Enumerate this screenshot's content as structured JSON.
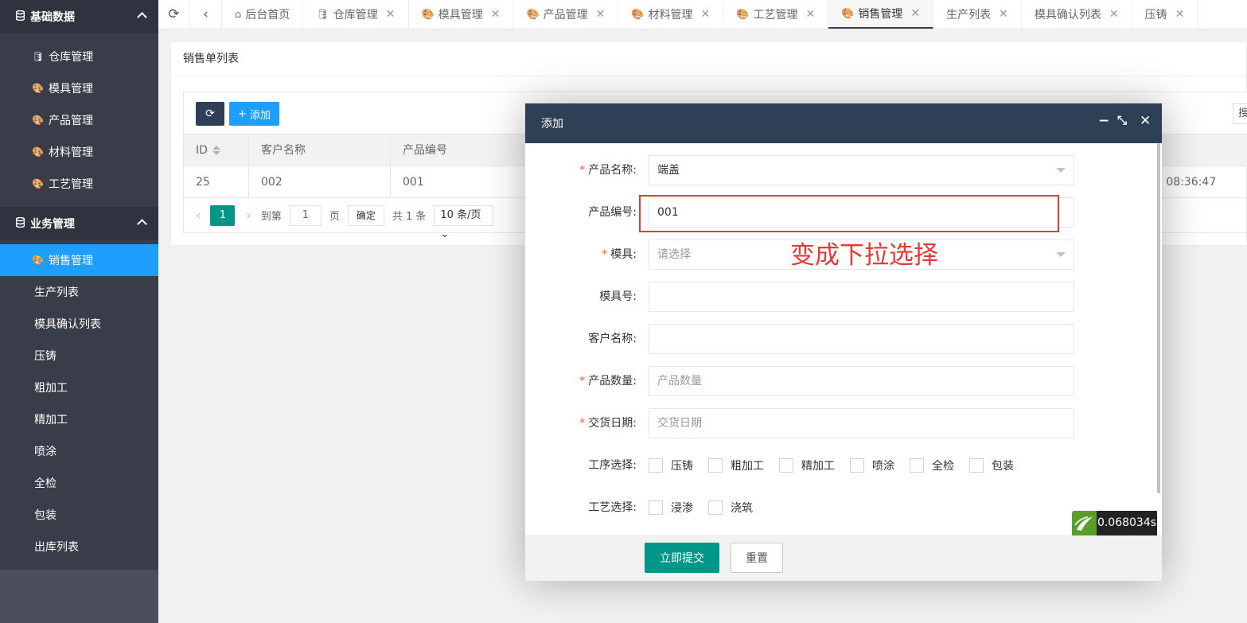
{
  "sidebar": {
    "group1": {
      "label": "基础数据"
    },
    "group1_items": [
      {
        "label": "仓库管理",
        "icon": "database-icon"
      },
      {
        "label": "模具管理",
        "icon": "palette-icon"
      },
      {
        "label": "产品管理",
        "icon": "palette-icon"
      },
      {
        "label": "材料管理",
        "icon": "palette-icon"
      },
      {
        "label": "工艺管理",
        "icon": "palette-icon"
      }
    ],
    "group2": {
      "label": "业务管理"
    },
    "group2_items": [
      {
        "label": "销售管理",
        "icon": "palette-icon",
        "active": true
      },
      {
        "label": "生产列表"
      },
      {
        "label": "模具确认列表"
      },
      {
        "label": "压铸"
      },
      {
        "label": "粗加工"
      },
      {
        "label": "精加工"
      },
      {
        "label": "喷涂"
      },
      {
        "label": "全检"
      },
      {
        "label": "包装"
      },
      {
        "label": "出库列表"
      }
    ]
  },
  "tabs": [
    {
      "label": "后台首页",
      "icon": "home-icon",
      "closable": false
    },
    {
      "label": "仓库管理",
      "icon": "database-icon",
      "closable": true
    },
    {
      "label": "模具管理",
      "icon": "palette-icon",
      "closable": true
    },
    {
      "label": "产品管理",
      "icon": "palette-icon",
      "closable": true
    },
    {
      "label": "材料管理",
      "icon": "palette-icon",
      "closable": true
    },
    {
      "label": "工艺管理",
      "icon": "palette-icon",
      "closable": true
    },
    {
      "label": "销售管理",
      "icon": "palette-icon",
      "closable": true,
      "active": true
    },
    {
      "label": "生产列表",
      "closable": true
    },
    {
      "label": "模具确认列表",
      "closable": true
    },
    {
      "label": "压铸",
      "closable": true
    }
  ],
  "card": {
    "title": "销售单列表",
    "add_button": "添加",
    "toolbar_right_fragment": "搜",
    "table": {
      "headers": [
        "ID",
        "客户名称",
        "产品编号"
      ],
      "row": {
        "id": "25",
        "customer": "002",
        "product_code": "001",
        "time_fragment": "0 08:36:47"
      }
    },
    "pager": {
      "current_page": "1",
      "goto_prefix": "到第",
      "goto_value": "1",
      "goto_suffix": "页",
      "confirm": "确定",
      "total": "共 1 条",
      "page_size": "10 条/页"
    }
  },
  "modal": {
    "title": "添加",
    "fields": {
      "product_name": {
        "label": "产品名称",
        "required": true,
        "value": "端盖"
      },
      "product_code": {
        "label": "产品编号",
        "required": false,
        "value": "001"
      },
      "mold": {
        "label": "模具",
        "required": true,
        "placeholder": "请选择"
      },
      "mold_no": {
        "label": "模具号",
        "required": false,
        "value": ""
      },
      "customer_name": {
        "label": "客户名称",
        "required": false,
        "value": ""
      },
      "quantity": {
        "label": "产品数量",
        "required": true,
        "placeholder": "产品数量"
      },
      "delivery_date": {
        "label": "交货日期",
        "required": true,
        "placeholder": "交货日期"
      }
    },
    "process_select": {
      "label": "工序选择",
      "options": [
        "压铸",
        "粗加工",
        "精加工",
        "喷涂",
        "全检",
        "包装"
      ]
    },
    "craft_select": {
      "label": "工艺选择",
      "options": [
        "浸渗",
        "浇筑"
      ]
    },
    "annotation": "变成下拉选择",
    "submit": "立即提交",
    "reset": "重置"
  },
  "debug_badge": {
    "time": "0.068034s"
  },
  "colors": {
    "sidebar_bg": "#393d49",
    "active_blue": "#1e9fff",
    "primary_teal": "#009688",
    "modal_header": "#2f4056",
    "required_star": "#ff5722",
    "annotation_red": "#e53935"
  }
}
